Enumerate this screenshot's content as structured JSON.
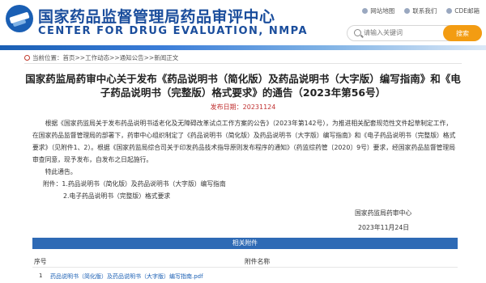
{
  "header": {
    "title_cn": "国家药品监督管理局药品审评中心",
    "title_en": "CENTER FOR DRUG EVALUATION, NMPA",
    "links": [
      {
        "label": "网站地图",
        "icon": "location-icon"
      },
      {
        "label": "联系我们",
        "icon": "contact-icon"
      },
      {
        "label": "CDE邮箱",
        "icon": "mail-icon"
      }
    ],
    "search": {
      "placeholder": "请输入关键词",
      "button": "搜索"
    }
  },
  "breadcrumb": "当前位置：首页>>工作动态>>通知公告>>新闻正文",
  "article": {
    "title": "国家药监局药审中心关于发布《药品说明书（简化版）及药品说明书（大字版）编写指南》和《电子药品说明书（完整版）格式要求》的通告（2023年第56号）",
    "pubdate": "发布日期：20231124",
    "para1": "根据《国家药监局关于发布药品说明书适老化及无障碍改革试点工作方案的公告》（2023年第142号），为推进相关配套规范性文件起草制定工作，在国家药品监督管理局的部署下，药审中心组织制定了《药品说明书（简化版）及药品说明书（大字版）编写指南》和《电子药品说明书（完整版）格式要求》（见附件1、2）。根据《国家药监局综合司关于印发药品技术指导原则发布程序的通知》（药监综药管〔2020〕9号）要求，经国家药品监督管理局审查同意，现予发布，自发布之日起施行。",
    "para2": "特此通告。",
    "attachment1": "附件：1.药品说明书（简化版）及药品说明书（大字版）编写指南",
    "attachment2": "2.电子药品说明书（完整版）格式要求",
    "signature": "国家药监局药审中心",
    "date": "2023年11月24日"
  },
  "attachments_table": {
    "heading": "相关附件",
    "columns": [
      "序号",
      "附件名称"
    ],
    "rows": [
      {
        "index": "1",
        "name": "药品说明书（简化版）及药品说明书（大字版）编写指南.pdf"
      }
    ]
  },
  "colors": {
    "brand_blue": "#1a4d9c",
    "search_button": "#f39c12",
    "table_header": "#2e6ab5",
    "date_red": "#c03030"
  }
}
